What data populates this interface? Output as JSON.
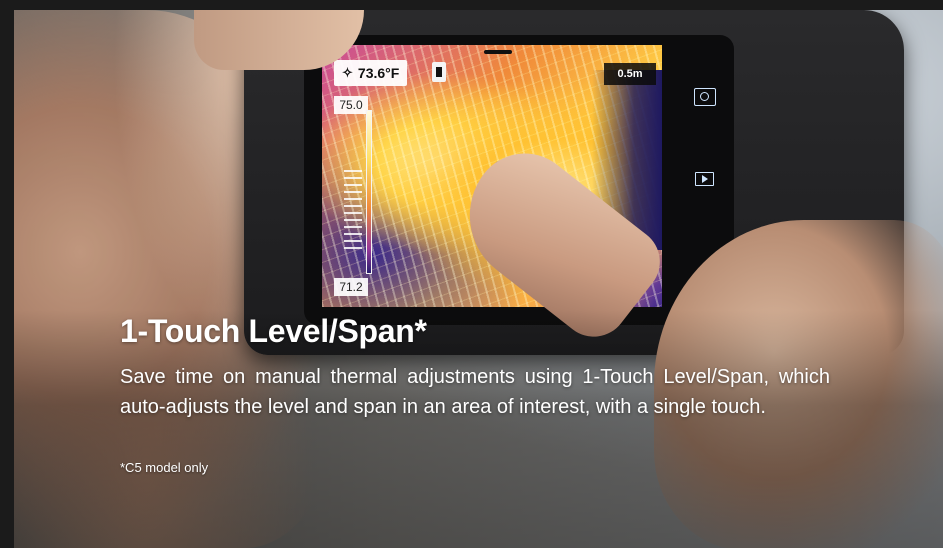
{
  "device_screen": {
    "spot_temperature": "73.6°F",
    "distance": "0.5m",
    "scale_max": "75.0",
    "scale_min": "71.2",
    "icons": [
      "crosshair-icon",
      "battery-icon",
      "camera-icon",
      "play-icon"
    ]
  },
  "caption": {
    "title": "1-Touch Level/Span*",
    "description": "Save time on manual thermal adjustments using 1-Touch Level/Span, which auto-adjusts the level and span in an area of interest, with a single touch.",
    "footnote": "*C5 model only"
  },
  "colors": {
    "background": "#1b1b1b",
    "text": "#ffffff",
    "overlay_badge": "#ffffff"
  }
}
